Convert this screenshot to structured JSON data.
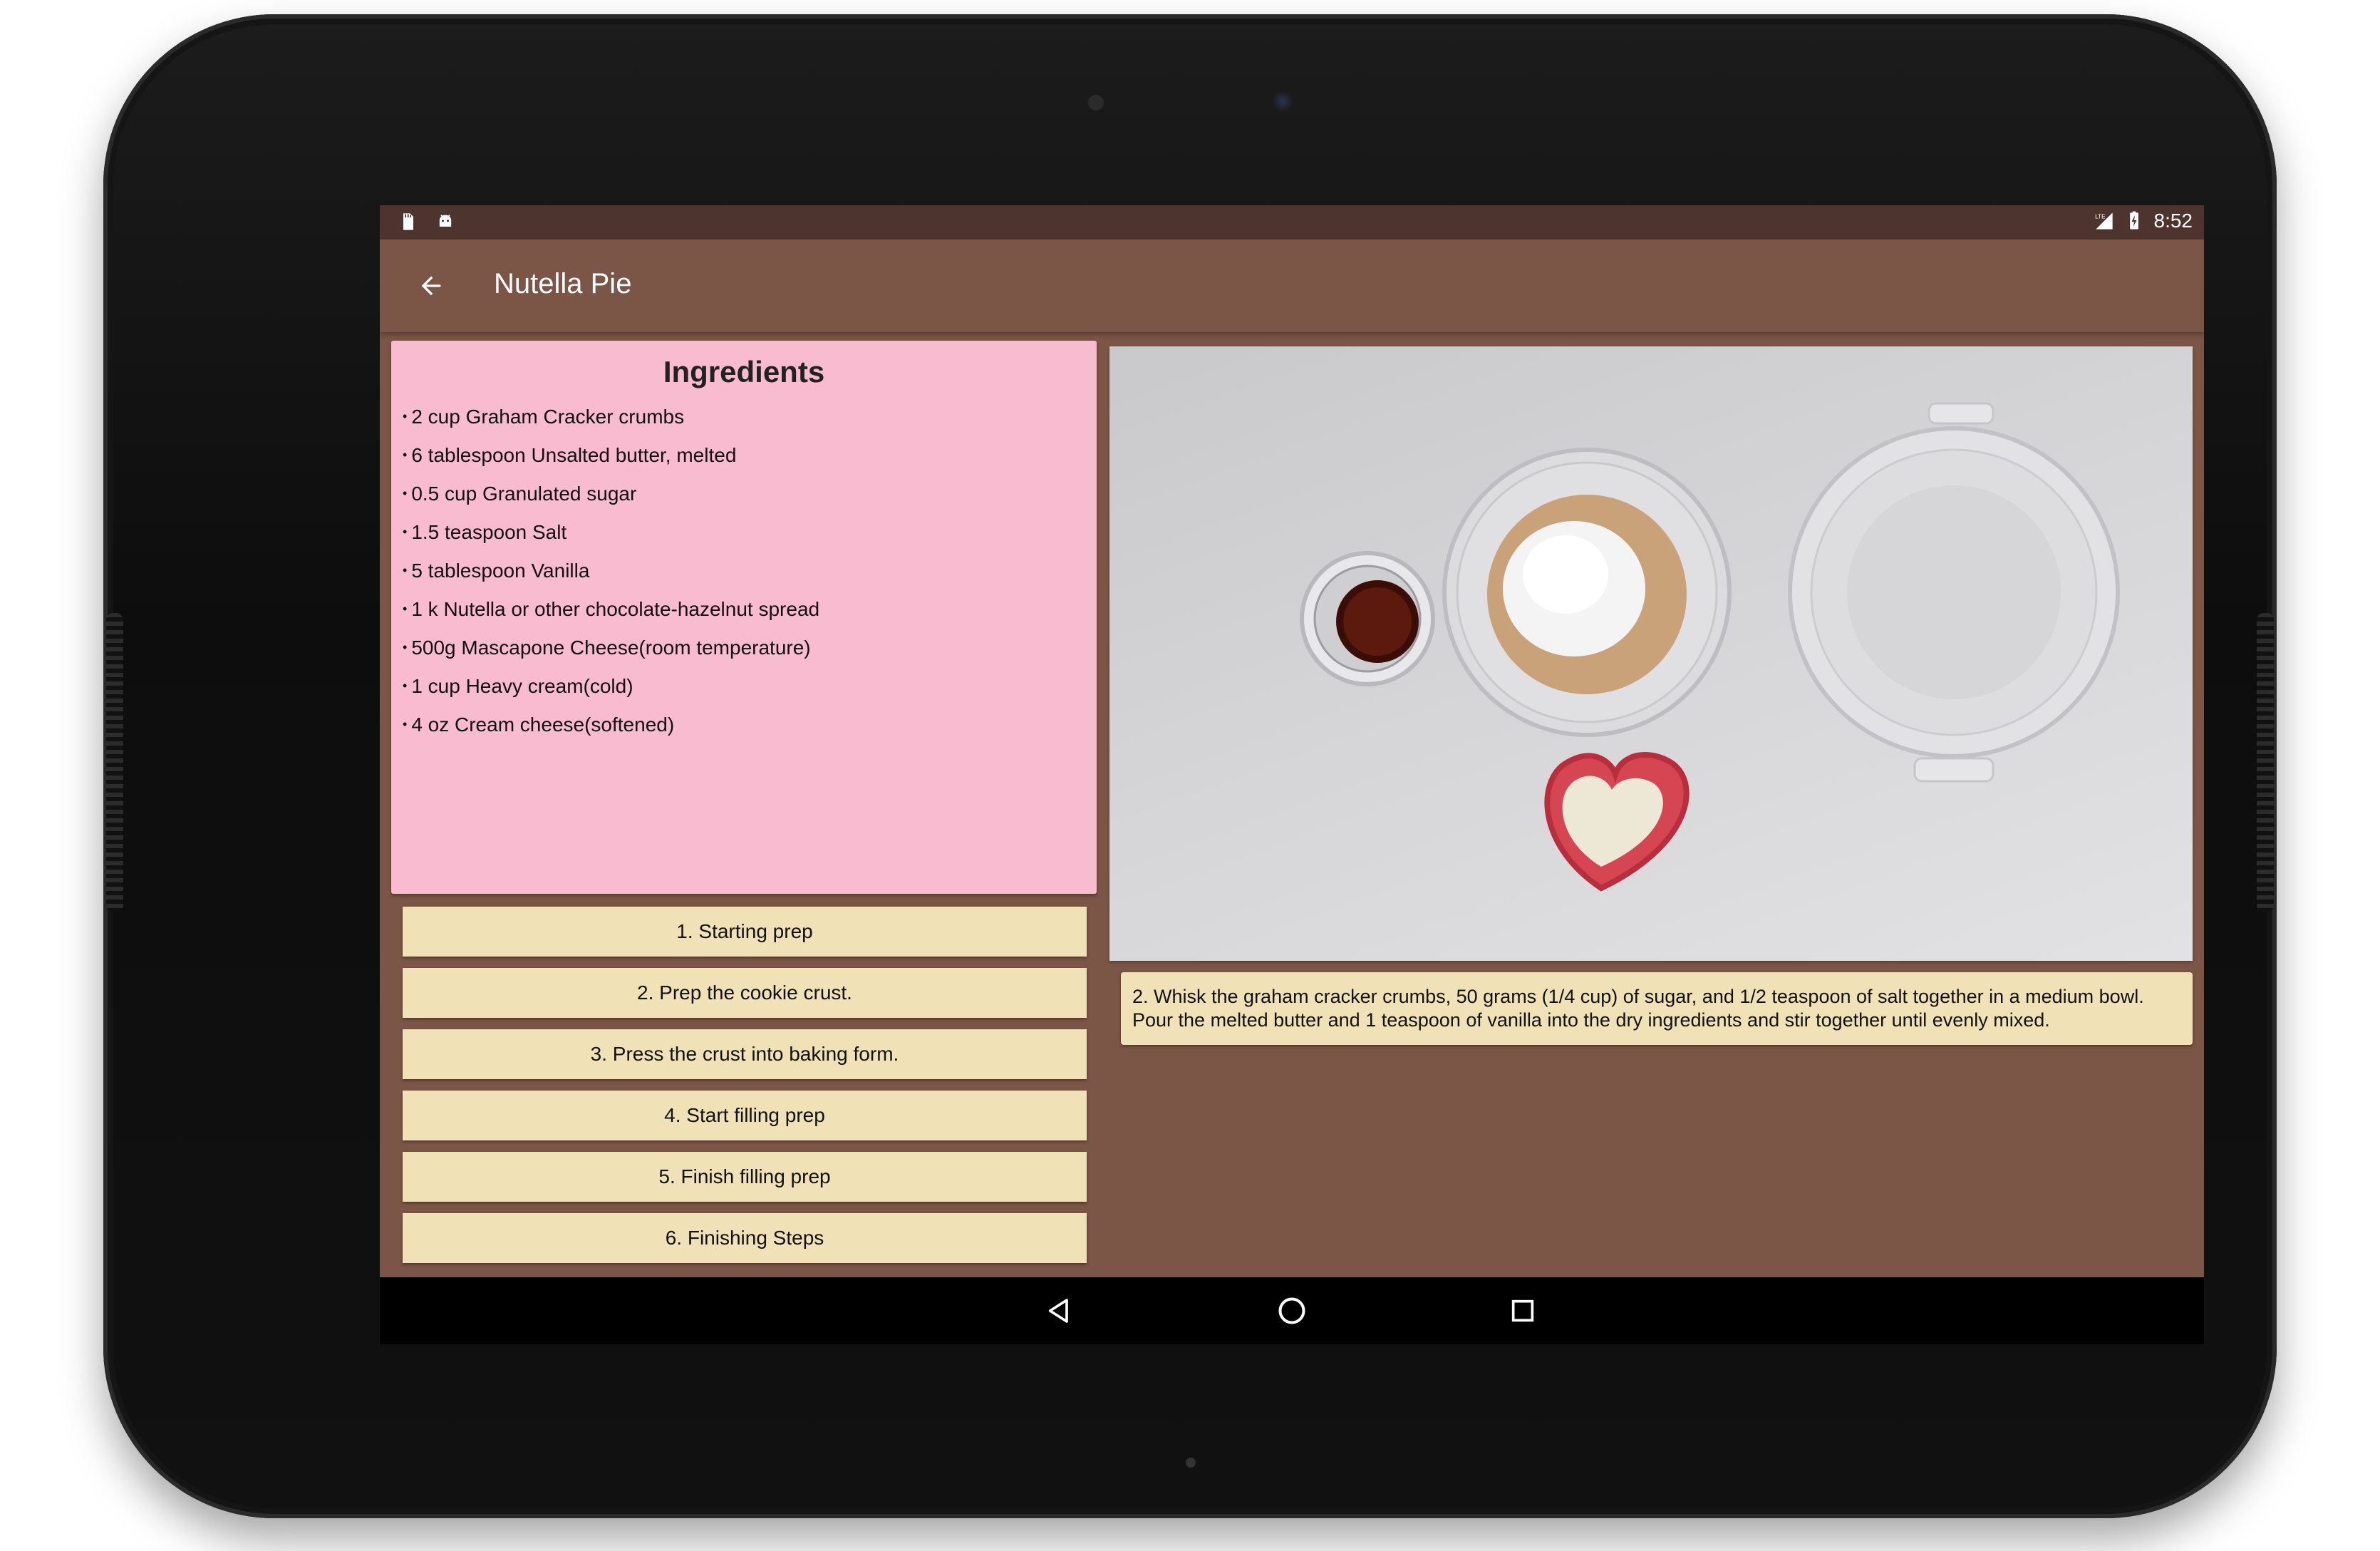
{
  "status_bar": {
    "left_icons": [
      "sd-card-icon",
      "android-icon"
    ],
    "time": "8:52",
    "right_icons": [
      "lte-signal-icon",
      "battery-charging-icon"
    ]
  },
  "app_bar": {
    "title": "Nutella Pie",
    "back_icon": "arrow-back-icon"
  },
  "ingredients": {
    "heading": "Ingredients",
    "items": [
      "2 cup Graham Cracker crumbs",
      "6 tablespoon Unsalted butter, melted",
      "0.5 cup Granulated sugar",
      "1.5 teaspoon Salt",
      "5 tablespoon Vanilla",
      "1 k Nutella or other chocolate-hazelnut spread",
      "500g Mascapone Cheese(room temperature)",
      "1 cup Heavy cream(cold)",
      "4 oz Cream cheese(softened)"
    ]
  },
  "steps": [
    "1. Starting prep",
    "2. Prep the cookie crust.",
    "3. Press the crust into baking form.",
    "4. Start filling prep",
    "5. Finish filling prep",
    "6. Finishing Steps"
  ],
  "step_description": "2. Whisk the graham cracker crumbs, 50 grams (1/4 cup) of sugar, and 1/2 teaspoon of salt together in a medium bowl. Pour the melted butter and 1 teaspoon of vanilla into the dry ingredients and stir together until evenly mixed.",
  "nav_bar": {
    "buttons": [
      "back-triangle-icon",
      "home-circle-icon",
      "recents-square-icon"
    ]
  },
  "colors": {
    "primary": "#7b5546",
    "primary_dark": "#4e342e",
    "ingredients_bg": "#f8bbd0",
    "step_bg": "#f0e2b6"
  }
}
